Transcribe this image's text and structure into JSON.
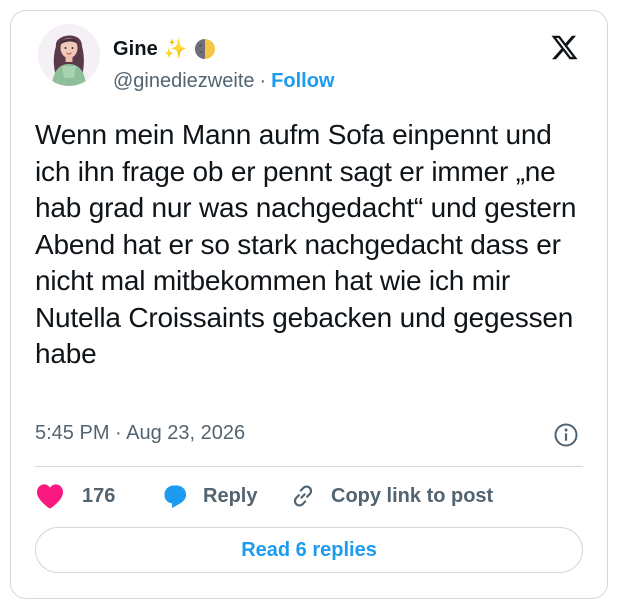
{
  "author": {
    "display_name": "Gine",
    "name_emoji": "✨",
    "handle": "@ginediezweite",
    "separator": "·",
    "follow_label": "Follow"
  },
  "tweet": {
    "text": "Wenn mein Mann aufm Sofa einpennt und ich ihn frage ob er pennt sagt er immer „ne hab grad nur was nachgedacht“ und gestern Abend hat er so stark nachgedacht dass er nicht mal mitbekommen hat wie ich mir Nutella Croissaints gebacken und gegessen habe",
    "timestamp": "5:45 PM · Aug 23, 2026"
  },
  "actions": {
    "like_count": "176",
    "reply_label": "Reply",
    "copy_label": "Copy link to post"
  },
  "footer": {
    "read_replies_label": "Read 6 replies"
  },
  "colors": {
    "accent": "#1d9bf0",
    "heart": "#f91880",
    "text": "#0f1419",
    "muted": "#536471",
    "border": "#cfd9de"
  },
  "icons": [
    "avatar-image",
    "sparkles-emoji",
    "half-moon-emoji",
    "x-logo-icon",
    "info-icon",
    "heart-icon",
    "reply-bubble-icon",
    "link-icon"
  ]
}
